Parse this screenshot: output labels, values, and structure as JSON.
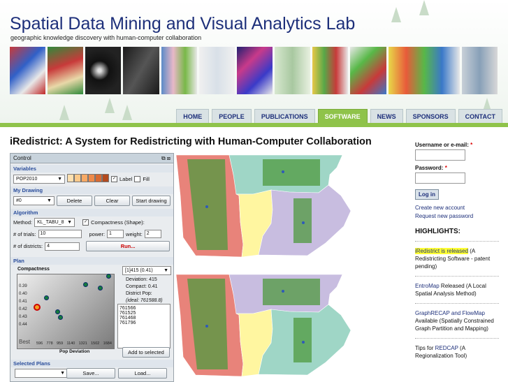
{
  "header": {
    "title": "Spatial Data Mining and Visual Analytics Lab",
    "slogan": "geographic knowledge discovery with human-computer collaboration"
  },
  "nav": [
    "HOME",
    "PEOPLE",
    "PUBLICATIONS",
    "SOFTWARE",
    "NEWS",
    "SPONSORS",
    "CONTACT"
  ],
  "nav_active": "SOFTWARE",
  "page_title": "iRedistrict: A System for Redistricting with Human-Computer Collaboration",
  "app": {
    "window_title": "Control",
    "variables_label": "Variables",
    "variable_value": "POP2010",
    "label_checkbox": "Label",
    "fill_checkbox": "Fill",
    "my_drawing_label": "My Drawing",
    "drawing_value": "#0",
    "delete_btn": "Delete",
    "clear_btn": "Clear",
    "start_btn": "Start drawing",
    "algorithm_label": "Algorithm",
    "method_label": "Method:",
    "method_value": "KL_TABU_8",
    "compactness_checkbox": "Compactness (Shape):",
    "trials_label": "# of trials:",
    "trials_value": "10",
    "power_label": "power:",
    "power_value": "1",
    "weight_label": "weight:",
    "weight_value": "2",
    "districts_label": "# of districts:",
    "districts_value": "4",
    "run_btn": "Run...",
    "plan_label": "Plan",
    "compactness_axis": "Compactness",
    "plan_select": "[1]415 (0.41)",
    "deviation": "Deviation: 415",
    "compact": "Compact: 0.41",
    "district_pop": "District Pop:",
    "ideal": "(ideal: 761588.8)",
    "pops": [
      "761566",
      "761525",
      "761468",
      "761796"
    ],
    "y_ticks": [
      "0.39",
      "0.40",
      "0.41",
      "0.42",
      "0.43",
      "0.44"
    ],
    "x_ticks": [
      "596",
      "778",
      "959",
      "1140",
      "1321",
      "1502",
      "1684"
    ],
    "best": "Best",
    "x_axis": "Pop Deviation",
    "add_btn": "Add to selected",
    "selected_label": "Selected Plans",
    "save_btn": "Save...",
    "load_btn": "Load..."
  },
  "sidebar": {
    "user_label": "Username or e-mail:",
    "pass_label": "Password:",
    "required": "*",
    "login": "Log in",
    "create": "Create new account",
    "request": "Request new password",
    "highlights": "HIGHLIGHTS:",
    "items": [
      {
        "link": "iRedistrict is released",
        "rest": " (A Redistricting Software - patent pending)"
      },
      {
        "link": "EntroMap",
        "rest": " Released (A Local Spatial Analysis Method)"
      },
      {
        "link": "GraphRECAP and FlowMap",
        "rest": " Available (Spatially Constrained Graph Partition and Mapping)"
      },
      {
        "link": "REDCAP",
        "pre": "Tips for ",
        "rest": " (A Regionalization Tool)"
      }
    ]
  },
  "colors": {
    "brand_blue": "#1d2f7a",
    "nav_active_green": "#8fc34a",
    "district_red": "#e8837a",
    "district_teal": "#9fd6c6",
    "district_yellow": "#fff6a0",
    "district_lavender": "#c8bde0",
    "highlight_box": "#4f9a3f"
  }
}
